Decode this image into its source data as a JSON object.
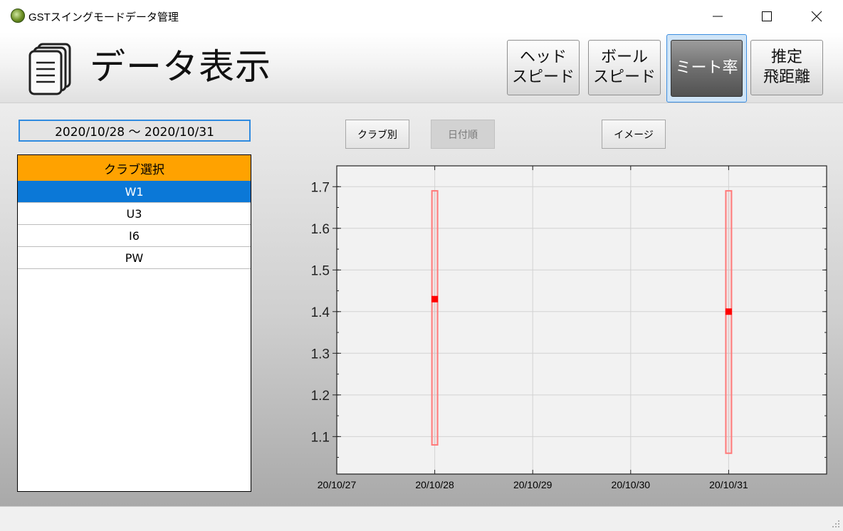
{
  "window": {
    "title": "GSTスイングモードデータ管理"
  },
  "header": {
    "title": "データ表示",
    "nav": {
      "head_speed": "ヘッド\nスピード",
      "ball_speed": "ボール\nスピード",
      "meet_rate": "ミート率",
      "est_distance": "推定\n飛距離"
    }
  },
  "toolbar": {
    "date_range": "2020/10/28 ～ 2020/10/31",
    "by_club": "クラブ別",
    "by_date": "日付順",
    "image": "イメージ"
  },
  "club_list": {
    "header": "クラブ選択",
    "items": [
      "W1",
      "U3",
      "I6",
      "PW"
    ],
    "selected": "W1"
  },
  "colors": {
    "accent": "#0b78d7",
    "club_header": "#ffa200",
    "series": "#ff0000"
  },
  "chart_data": {
    "type": "boxplot",
    "x_tick_labels": [
      "20/10/27",
      "20/10/28",
      "20/10/29",
      "20/10/30",
      "20/10/31"
    ],
    "y_ticks": [
      1.1,
      1.2,
      1.3,
      1.4,
      1.5,
      1.6,
      1.7
    ],
    "ylim": [
      1.01,
      1.75
    ],
    "grid": true,
    "series": [
      {
        "x": "20/10/28",
        "min": 1.08,
        "max": 1.69,
        "mean": 1.43
      },
      {
        "x": "20/10/31",
        "min": 1.06,
        "max": 1.69,
        "mean": 1.4
      }
    ]
  }
}
